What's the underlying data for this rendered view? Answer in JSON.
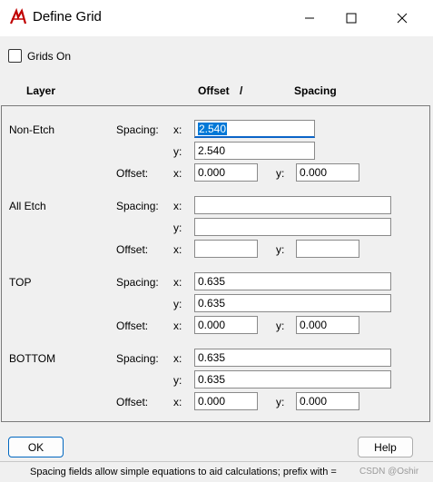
{
  "window": {
    "title": "Define Grid"
  },
  "grids_on": {
    "label": "Grids On",
    "checked": false
  },
  "headers": {
    "layer": "Layer",
    "offset": "Offset",
    "sep": "/",
    "spacing": "Spacing"
  },
  "labels": {
    "spacing": "Spacing:",
    "offset": "Offset:",
    "x": "x:",
    "y": "y:"
  },
  "sections": [
    {
      "name": "Non-Etch",
      "spacing_x": "2.540",
      "spacing_y": "2.540",
      "offset_x": "0.000",
      "offset_y": "0.000"
    },
    {
      "name": "All Etch",
      "spacing_x": "",
      "spacing_y": "",
      "offset_x": "",
      "offset_y": ""
    },
    {
      "name": "TOP",
      "spacing_x": "0.635",
      "spacing_y": "0.635",
      "offset_x": "0.000",
      "offset_y": "0.000"
    },
    {
      "name": "BOTTOM",
      "spacing_x": "0.635",
      "spacing_y": "0.635",
      "offset_x": "0.000",
      "offset_y": "0.000"
    }
  ],
  "buttons": {
    "ok": "OK",
    "help": "Help"
  },
  "status_text": "Spacing fields allow simple equations to aid calculations; prefix with =",
  "watermark": "CSDN @Oshir"
}
